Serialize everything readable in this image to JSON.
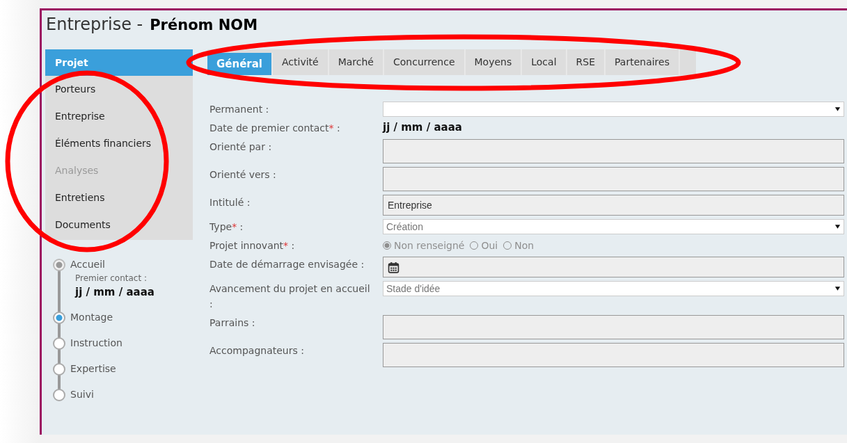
{
  "window": {
    "title": "Entreprise -",
    "person": "Prénom NOM"
  },
  "sidebar": {
    "items": [
      {
        "label": "Projet",
        "selected": true,
        "disabled": false
      },
      {
        "label": "Porteurs",
        "selected": false,
        "disabled": false
      },
      {
        "label": "Entreprise",
        "selected": false,
        "disabled": false
      },
      {
        "label": "Éléments financiers",
        "selected": false,
        "disabled": false
      },
      {
        "label": "Analyses",
        "selected": false,
        "disabled": true
      },
      {
        "label": "Entretiens",
        "selected": false,
        "disabled": false
      },
      {
        "label": "Documents",
        "selected": false,
        "disabled": false
      }
    ]
  },
  "steps": [
    {
      "label": "Accueil",
      "selected": true,
      "disabled": true,
      "detail_label": "Premier contact :",
      "detail_value": "jj / mm / aaaa"
    },
    {
      "label": "Montage",
      "selected": true,
      "disabled": false
    },
    {
      "label": "Instruction",
      "selected": false,
      "disabled": false
    },
    {
      "label": "Expertise",
      "selected": false,
      "disabled": false
    },
    {
      "label": "Suivi",
      "selected": false,
      "disabled": false
    }
  ],
  "tabs": [
    {
      "label": "Général",
      "selected": true
    },
    {
      "label": "Activité",
      "selected": false
    },
    {
      "label": "Marché",
      "selected": false
    },
    {
      "label": "Concurrence",
      "selected": false
    },
    {
      "label": "Moyens",
      "selected": false
    },
    {
      "label": "Local",
      "selected": false
    },
    {
      "label": "RSE",
      "selected": false
    },
    {
      "label": "Partenaires",
      "selected": false
    }
  ],
  "form": [
    {
      "kind": "select",
      "label": "Permanent :"
    },
    {
      "kind": "text",
      "label": "Date de premier contact",
      "mark": "*",
      "suffix": " :",
      "value": "jj / mm / aaaa"
    },
    {
      "kind": "textarea",
      "label": "Orienté par :"
    },
    {
      "kind": "textarea",
      "label": "Orienté vers :"
    },
    {
      "kind": "input",
      "label": "Intitulé :",
      "value": "Entreprise"
    },
    {
      "kind": "select",
      "label": "Type",
      "mark": "*",
      "suffix": " :",
      "value": "Création"
    },
    {
      "kind": "radio",
      "label": "Projet innovant",
      "mark": "*",
      "suffix": " :",
      "disabled": true,
      "options": [
        {
          "label": "Non renseigné",
          "selected": true
        },
        {
          "label": "Oui",
          "selected": false
        },
        {
          "label": "Non",
          "selected": false
        }
      ]
    },
    {
      "kind": "date",
      "label": "Date de démarrage envisagée :"
    },
    {
      "kind": "select",
      "label": "Avancement du projet en accueil :",
      "value": "Stade d'idée"
    },
    {
      "kind": "textarea",
      "label": "Parrains :"
    },
    {
      "kind": "textarea",
      "label": "Accompagnateurs :"
    }
  ],
  "annotations": [
    {
      "kind": "ellipse"
    },
    {
      "kind": "ellipse"
    }
  ]
}
